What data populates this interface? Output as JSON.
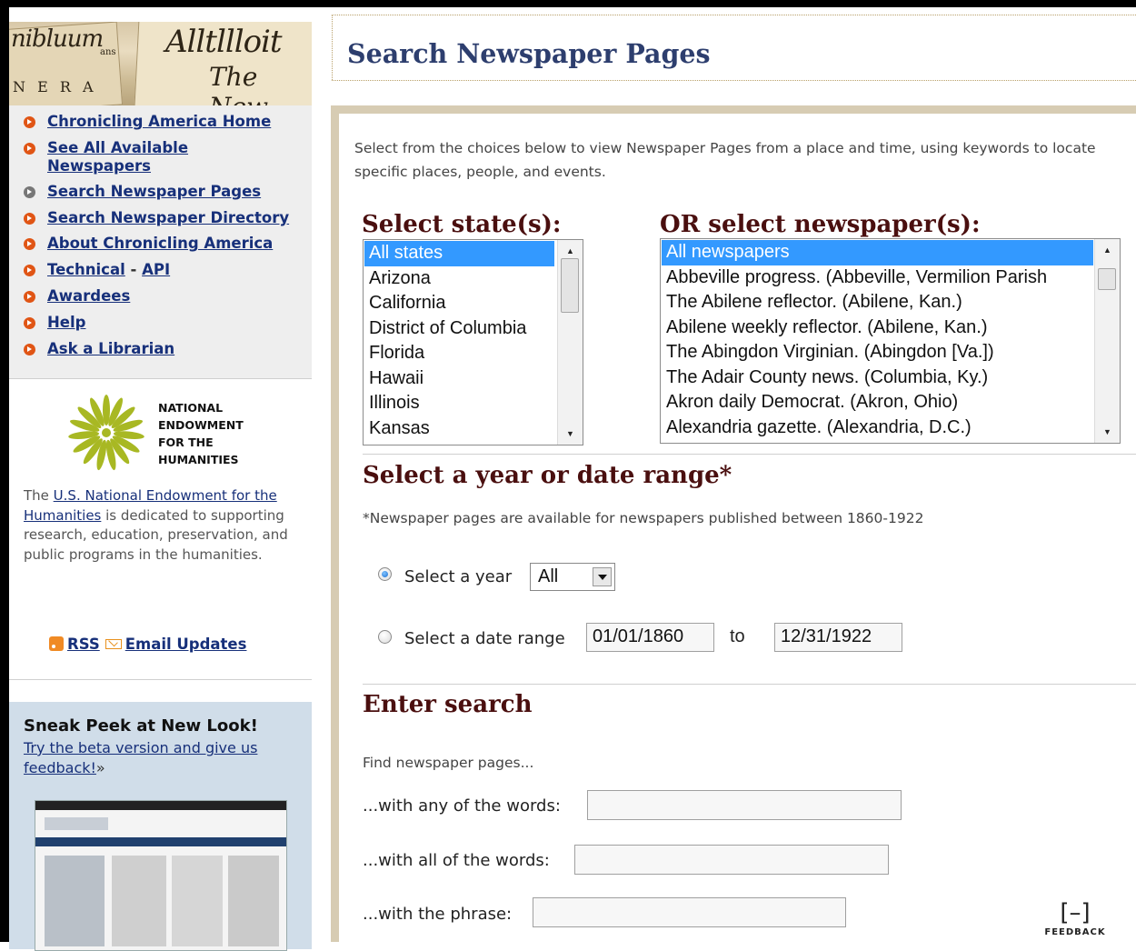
{
  "banner": {
    "fragments": [
      "nibluum",
      "Alltllloit",
      "The New",
      "N E R A",
      "ans"
    ]
  },
  "nav": {
    "items": [
      {
        "label": "Chronicling America Home"
      },
      {
        "label": "See All Available"
      },
      {
        "label": "Newspapers"
      },
      {
        "label": "Search Newspaper Pages"
      },
      {
        "label": "Search Newspaper Directory"
      },
      {
        "label": "About Chronicling America"
      },
      {
        "label": "Technical"
      },
      {
        "label": "API"
      },
      {
        "label": "Awardees"
      },
      {
        "label": "Help"
      },
      {
        "label": "Ask a Librarian"
      }
    ],
    "separator": " - "
  },
  "neh": {
    "logo_lines": [
      "NATIONAL",
      "ENDOWMENT",
      "FOR THE",
      "HUMANITIES"
    ],
    "desc_prefix": "The ",
    "desc_link": "U.S. National Endowment for the Humanities",
    "desc_suffix": " is dedicated to supporting research, education, preservation, and public programs in the humanities."
  },
  "feeds": {
    "rss_label": "RSS",
    "email_label": "Email Updates",
    "icons": [
      "rss-icon",
      "mail-icon"
    ]
  },
  "peek": {
    "title": "Sneak Peek at New Look!",
    "link": "Try the beta version and give us feedback!",
    "arrow": "»"
  },
  "page": {
    "title": "Search Newspaper Pages",
    "intro": "Select from the choices below to view Newspaper Pages from a place and time, using keywords to locate specific places, people, and events."
  },
  "state": {
    "heading": "Select state(s):",
    "options": [
      "All states",
      "Arizona",
      "California",
      "District of Columbia",
      "Florida",
      "Hawaii",
      "Illinois",
      "Kansas"
    ],
    "selected": "All states"
  },
  "papers": {
    "heading": "OR select newspaper(s):",
    "options": [
      "All newspapers",
      "Abbeville progress. (Abbeville, Vermilion Parish",
      "The Abilene reflector. (Abilene, Kan.)",
      "Abilene weekly reflector. (Abilene, Kan.)",
      "The Abingdon Virginian. (Abingdon [Va.])",
      "The Adair County news. (Columbia, Ky.)",
      "Akron daily Democrat. (Akron, Ohio)",
      "Alexandria gazette. (Alexandria, D.C.)"
    ],
    "selected": "All newspapers"
  },
  "date": {
    "heading": "Select a year or date range*",
    "note": "*Newspaper pages are available for newspapers published between 1860-1922",
    "year_label": "Select a year",
    "year_value": "All",
    "range_label": "Select a date range",
    "from": "01/01/1860",
    "to_label": "to",
    "to": "12/31/1922",
    "selected_mode": "year"
  },
  "search": {
    "heading": "Enter search",
    "find": "Find newspaper pages...",
    "any_label": "...with any of the words:",
    "any_value": "",
    "all_label": "...with all of the words:",
    "all_value": "",
    "phrase_label": "...with the phrase:",
    "phrase_value": ""
  },
  "feedback": {
    "glyph": "[–]",
    "label": "FEEDBACK"
  },
  "colors": {
    "nav_link": "#17307a",
    "nav_bullet": "#e05515",
    "heading": "#4a0f0f",
    "title": "#2d3e6e",
    "panel_border": "#d7ccb3",
    "list_selected": "#3399ff"
  }
}
